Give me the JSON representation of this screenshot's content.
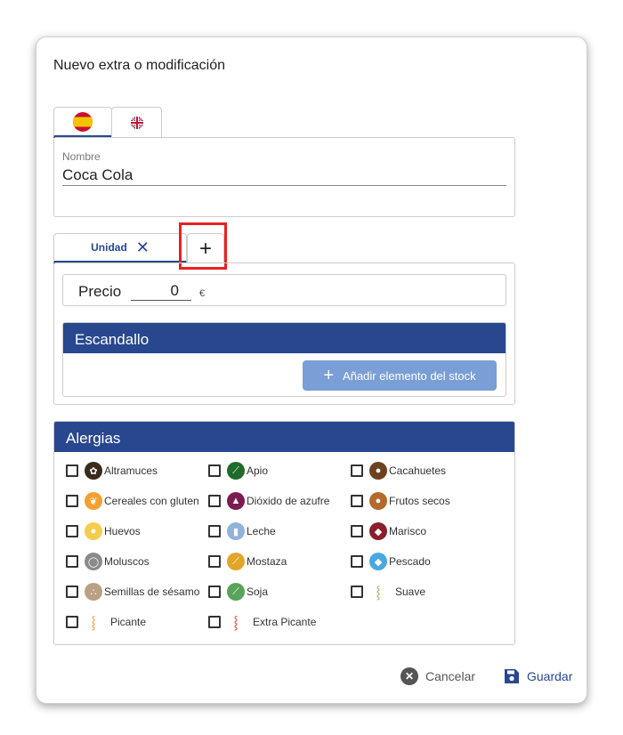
{
  "dialog": {
    "title": "Nuevo extra o modificación"
  },
  "languages": [
    {
      "name": "spanish-flag-icon",
      "active": true
    },
    {
      "name": "uk-flag-icon",
      "active": false
    }
  ],
  "name_field": {
    "label": "Nombre",
    "value": "Coca Cola"
  },
  "unit_tabs": {
    "active_label": "Unidad",
    "close_glyph": "✕",
    "add_glyph": "+"
  },
  "price": {
    "label": "Precio",
    "value": "0",
    "currency": "€"
  },
  "escandallo": {
    "title": "Escandallo",
    "add_button": "Añadir elemento del stock"
  },
  "allergies": {
    "title": "Alergias",
    "items": [
      {
        "label": "Altramuces",
        "color": "#3a2a1c",
        "icon": "lupin-icon",
        "glyph": "✿"
      },
      {
        "label": "Apio",
        "color": "#1f6b2c",
        "icon": "celery-icon",
        "glyph": "⟋"
      },
      {
        "label": "Cacahuetes",
        "color": "#6b4220",
        "icon": "peanut-icon",
        "glyph": "●"
      },
      {
        "label": "Cereales con gluten",
        "color": "#f0a132",
        "icon": "gluten-icon",
        "glyph": "❦"
      },
      {
        "label": "Dióxido de azufre",
        "color": "#7b1b52",
        "icon": "sulphite-icon",
        "glyph": "▲"
      },
      {
        "label": "Frutos secos",
        "color": "#b36a2a",
        "icon": "nuts-icon",
        "glyph": "●"
      },
      {
        "label": "Huevos",
        "color": "#f5cd4e",
        "icon": "egg-icon",
        "glyph": "●"
      },
      {
        "label": "Leche",
        "color": "#92b3d9",
        "icon": "milk-icon",
        "glyph": "▮"
      },
      {
        "label": "Marisco",
        "color": "#8b1d2c",
        "icon": "shellfish-icon",
        "glyph": "◆"
      },
      {
        "label": "Moluscos",
        "color": "#8a8a8a",
        "icon": "mollusc-icon",
        "glyph": "◯"
      },
      {
        "label": "Mostaza",
        "color": "#e0a52a",
        "icon": "mustard-icon",
        "glyph": "⟋"
      },
      {
        "label": "Pescado",
        "color": "#4aa8e0",
        "icon": "fish-icon",
        "glyph": "◆"
      },
      {
        "label": "Semillas de sésamo",
        "color": "#b9a184",
        "icon": "sesame-icon",
        "glyph": "∴"
      },
      {
        "label": "Soja",
        "color": "#5aa35a",
        "icon": "soy-icon",
        "glyph": "⟋"
      },
      {
        "label": "Suave",
        "color": "#7cb33a",
        "icon": "mild-pepper-icon",
        "glyph": "⸾"
      },
      {
        "label": "Picante",
        "color": "#f08a1a",
        "icon": "hot-pepper-icon",
        "glyph": "⸾"
      },
      {
        "label": "Extra Picante",
        "color": "#e0221e",
        "icon": "extra-hot-pepper-icon",
        "glyph": "⸾"
      }
    ]
  },
  "footer": {
    "cancel": "Cancelar",
    "save": "Guardar"
  },
  "colors": {
    "primary": "#28478f",
    "button_light": "#7a9ed6",
    "highlight": "#e8211f"
  }
}
